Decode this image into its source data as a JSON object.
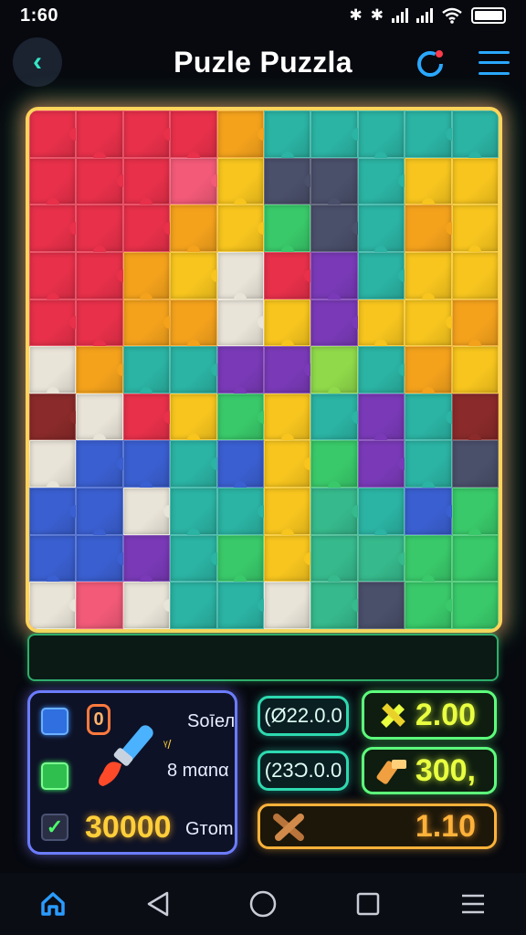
{
  "status_bar": {
    "time": "1:60",
    "icons": [
      "bluetooth-icon",
      "bluetooth-icon",
      "signal-icon",
      "signal-icon",
      "wifi-icon",
      "battery-icon"
    ]
  },
  "header": {
    "title": "Puzle Puzzla",
    "back_icon": "chevron-left-icon",
    "refresh_icon": "refresh-icon",
    "menu_icon": "hamburger-icon"
  },
  "colors": {
    "accent_teal": "#2ed9b0",
    "accent_green": "#5dff7c",
    "accent_yellow": "#e9ff40",
    "accent_orange": "#ffcf3a",
    "panel_border": "#6c7cff"
  },
  "board": {
    "rows": 11,
    "cols": 10,
    "palette": {
      "R": "#e8304a",
      "P": "#f25a78",
      "O": "#f4a21c",
      "Y": "#f7c51e",
      "W": "#e9e4d8",
      "B": "#3a5fd0",
      "V": "#7a3ab8",
      "T": "#2bb3a3",
      "G": "#39c96a",
      "L": "#8fd94a",
      "D": "#4a4f6a",
      "K": "#8a2a2a",
      "S": "#36b98c"
    },
    "layout": [
      "RRRROTTTTT",
      "RRRPYDDTYY",
      "RRROYGDTOY",
      "RROYWRVTYY",
      "RROOWYVYYO",
      "WOTTVVLTOY",
      "KWRYGYTVTK",
      "WBBTBYGVTD",
      "BBWTTYSTBG",
      "BBVTGYSSGG",
      "WPWTTWSDGG"
    ]
  },
  "stats_panel": {
    "badge": "0",
    "label_top": "Sоīел",
    "label_mid": "8 mαnα",
    "score": "30000",
    "score_unit": "Gтom",
    "icons": [
      "film-icon",
      "paint-brush-icon",
      "bucket-icon",
      "checkmark-icon"
    ]
  },
  "pills": {
    "left": [
      "(Ø22.0.0",
      "(23Ͻ.0.0"
    ],
    "right": [
      {
        "icon": "sparkle-icon",
        "value": "2.00"
      },
      {
        "icon": "hammer-icon",
        "value": "300,"
      },
      {
        "icon": "tools-icon",
        "value": "1.10"
      }
    ]
  },
  "nav": {
    "items": [
      "home-icon",
      "back-triangle-icon",
      "circle-home-icon",
      "recents-square-icon",
      "menu-lines-icon"
    ]
  }
}
